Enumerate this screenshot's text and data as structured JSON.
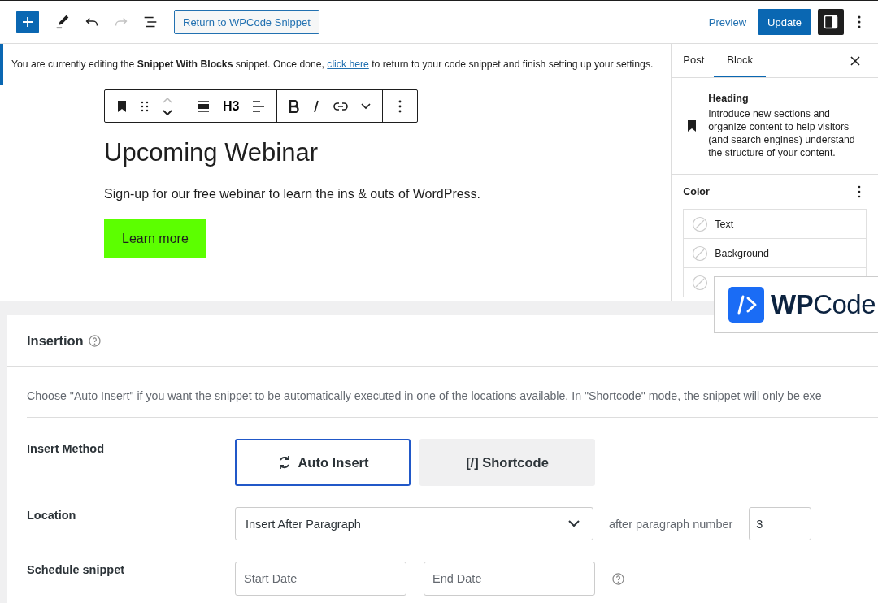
{
  "topbar": {
    "return_button": "Return to WPCode Snippet",
    "redo_disabled": true,
    "preview": "Preview",
    "update": "Update",
    "settings_toggled": true
  },
  "notice": {
    "text": "You are currently editing the **Snippet With Blocks** snippet. Once done,",
    "link": "click here",
    "after": "to return to your code snippet and finish setting up your settings."
  },
  "block_toolbar": {
    "heading_level": "H3"
  },
  "editor": {
    "heading": "Upcoming Webinar",
    "paragraph": "Sign-up for our free webinar to learn the ins & outs of WordPress.",
    "button": "Learn more"
  },
  "sidebar": {
    "tabs": [
      {
        "label": "Post",
        "selected": false
      },
      {
        "label": "Block",
        "selected": true
      }
    ],
    "block_title": "Heading",
    "block_description": "Introduce new sections and organize content to help visitors (and search engines) understand the structure of your content.",
    "color_heading": "Color",
    "color_items": [
      {
        "kind": "row",
        "label": "Text"
      },
      {
        "kind": "row",
        "label": "Background"
      },
      {
        "kind": "covered"
      }
    ]
  },
  "logo": {
    "text": "**WP**Code"
  },
  "insertion": {
    "title": "Insertion",
    "description": "Choose \"Auto Insert\" if you want the snippet to be automatically executed in one of the locations available. In \"Shortcode\" mode, the snippet will only be exe",
    "method_label": "Insert Method",
    "methods": [
      {
        "kind": "auto",
        "label": "Auto Insert",
        "selected": true
      },
      {
        "kind": "shortcode",
        "label": "[/] Shortcode",
        "selected": false
      }
    ],
    "location_label": "Location",
    "location_value": "Insert After Paragraph",
    "after_label": "after paragraph number",
    "after_value": "3",
    "schedule_label": "Schedule snippet",
    "start_placeholder": "Start Date",
    "end_placeholder": "End Date"
  }
}
